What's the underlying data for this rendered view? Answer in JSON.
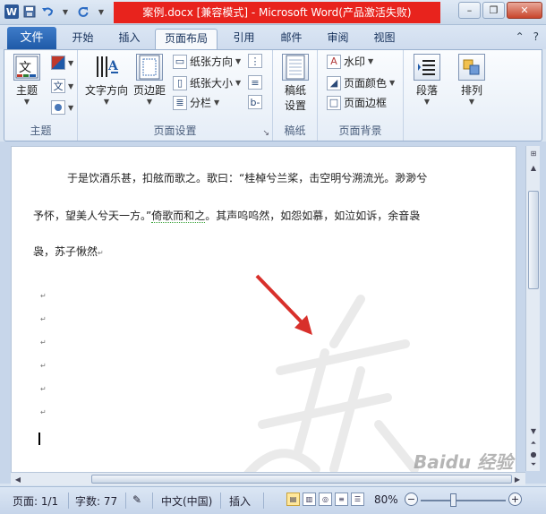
{
  "title_bar": {
    "title": "案例.docx [兼容模式] - Microsoft Word(产品激活失败)",
    "app_icon": "W",
    "title_bg_color": "#e8231d"
  },
  "tabs": {
    "file": "文件",
    "items": [
      "开始",
      "插入",
      "页面布局",
      "引用",
      "邮件",
      "审阅",
      "视图"
    ],
    "active": "页面布局"
  },
  "ribbon": {
    "themes_group": {
      "label": "主题",
      "themes_button": "主题",
      "colors_icon": "theme-colors-icon",
      "fonts_icon": "文",
      "effects_icon": "theme-effects-icon"
    },
    "page_setup_group": {
      "label": "页面设置",
      "text_direction": "文字方向",
      "margins": "页边距",
      "orientation": "纸张方向",
      "size": "纸张大小",
      "columns": "分栏"
    },
    "manuscript_group": {
      "label": "稿纸",
      "manuscript_setup_line1": "稿纸",
      "manuscript_setup_line2": "设置"
    },
    "page_background_group": {
      "label": "页面背景",
      "watermark": "水印",
      "page_color": "页面颜色",
      "page_borders": "页面边框"
    },
    "paragraph_button": "段落",
    "arrange_button": "排列"
  },
  "document": {
    "line1": "于是饮酒乐甚，扣舷而歌之。歌曰：“桂棹兮兰桨，击空明兮溯流光。渺渺兮",
    "line2_a": "予怀，望美人兮天一方。”",
    "line2_b": "倚歌而和之",
    "line2_c": "。其声呜呜然，如怨如慕，如泣如诉，余音袅",
    "line3": "袅，苏子愀然",
    "paragraph_mark": "↵"
  },
  "status_bar": {
    "page": "页面: 1/1",
    "word_count": "字数: 77",
    "language": "中文(中国)",
    "insert_mode": "插入",
    "zoom": "80%",
    "zoom_minus": "−",
    "zoom_plus": "+"
  },
  "watermark_text": "Baidu 经验"
}
